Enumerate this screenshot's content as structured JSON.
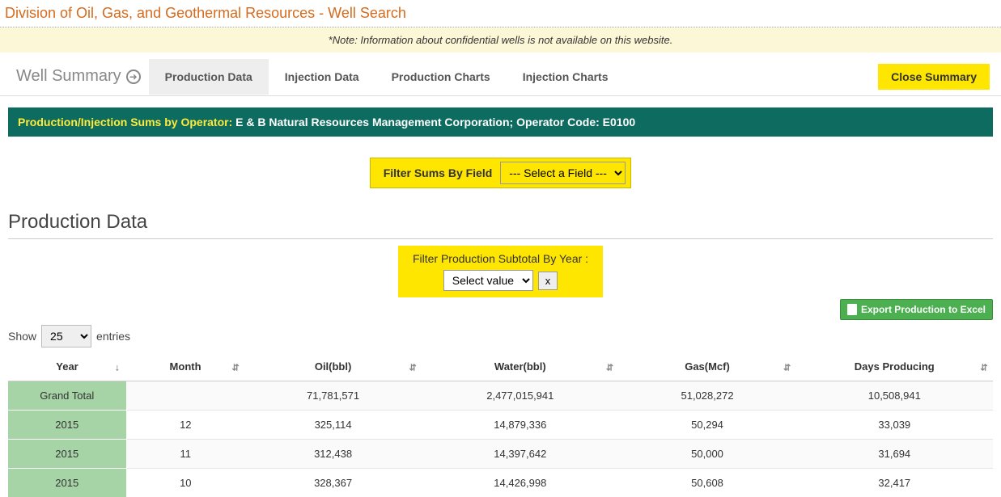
{
  "page_title": "Division of Oil, Gas, and Geothermal Resources - Well Search",
  "note": "*Note: Information about confidential wells is not available on this website.",
  "well_summary_label": "Well Summary",
  "tabs": {
    "production_data": "Production Data",
    "injection_data": "Injection Data",
    "production_charts": "Production Charts",
    "injection_charts": "Injection Charts"
  },
  "close_summary": "Close Summary",
  "banner": {
    "label": "Production/Injection Sums by Operator:",
    "value": " E & B Natural Resources Management Corporation; Operator Code: E0100"
  },
  "filter_field": {
    "label": "Filter Sums By Field",
    "selected": "--- Select a Field ---"
  },
  "section_title": "Production Data",
  "subtotal": {
    "label": "Filter Production Subtotal By Year :",
    "selected": "Select value",
    "clear": "x"
  },
  "export_label": "Export Production to Excel",
  "show_entries": {
    "prefix": "Show",
    "value": "25",
    "suffix": "entries"
  },
  "columns": {
    "year": "Year",
    "month": "Month",
    "oil": "Oil(bbl)",
    "water": "Water(bbl)",
    "gas": "Gas(Mcf)",
    "days": "Days Producing"
  },
  "rows": [
    {
      "year": "Grand Total",
      "month": "",
      "oil": "71,781,571",
      "water": "2,477,015,941",
      "gas": "51,028,272",
      "days": "10,508,941"
    },
    {
      "year": "2015",
      "month": "12",
      "oil": "325,114",
      "water": "14,879,336",
      "gas": "50,294",
      "days": "33,039"
    },
    {
      "year": "2015",
      "month": "11",
      "oil": "312,438",
      "water": "14,397,642",
      "gas": "50,000",
      "days": "31,694"
    },
    {
      "year": "2015",
      "month": "10",
      "oil": "328,367",
      "water": "14,426,998",
      "gas": "50,608",
      "days": "32,417"
    }
  ]
}
